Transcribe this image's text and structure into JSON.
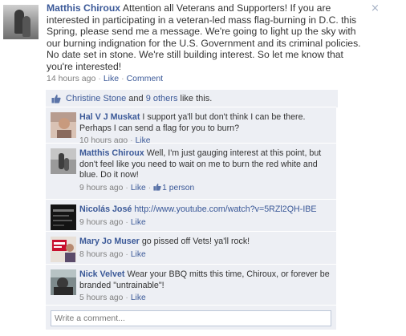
{
  "post": {
    "author": "Matthis Chiroux",
    "text": "Attention all Veterans and Supporters! If you are interested in participating in a veteran-led mass flag-burning in D.C. this Spring, please send me a message. We're going to light up the sky with our burning indignation for the U.S. Government and its criminal policies. No date set in stone. We're still building interest. So let me know that you're interested!",
    "time": "14 hours ago",
    "sep": "·",
    "like_label": "Like",
    "comment_label": "Comment",
    "close_glyph": "×"
  },
  "likes": {
    "name": "Christine Stone",
    "and": "and",
    "others": "9 others",
    "suffix": "like this."
  },
  "comments": [
    {
      "name": "Hal V J Muskat",
      "text": "I support ya'll but don't think I can be there. Perhaps I can send a flag for you to burn?",
      "time": "10 hours ago",
      "like_label": "Like"
    },
    {
      "name": "Matthis Chiroux",
      "text": "Well, I'm just gauging interest at this point, but don't feel like you need to wait on me to burn the red white and blue. Do it now!",
      "time": "9 hours ago",
      "like_label": "Like",
      "likes_count": "1 person"
    },
    {
      "name": "Nicolás José",
      "text": "http://www.youtube.com/watch?v=5RZl2QH-IBE",
      "time": "9 hours ago",
      "like_label": "Like"
    },
    {
      "name": "Mary Jo Muser",
      "text": "go pissed off Vets! ya'll rock!",
      "time": "8 hours ago",
      "like_label": "Like"
    },
    {
      "name": "Nick Velvet",
      "text": "Wear your BBQ mitts this time, Chiroux, or forever be branded \"untrainable\"!",
      "time": "5 hours ago",
      "like_label": "Like"
    }
  ],
  "composer": {
    "placeholder": "Write a comment..."
  },
  "colors": {
    "link": "#3b5998",
    "feedback_bg": "#edeff4",
    "meta": "#808080"
  }
}
